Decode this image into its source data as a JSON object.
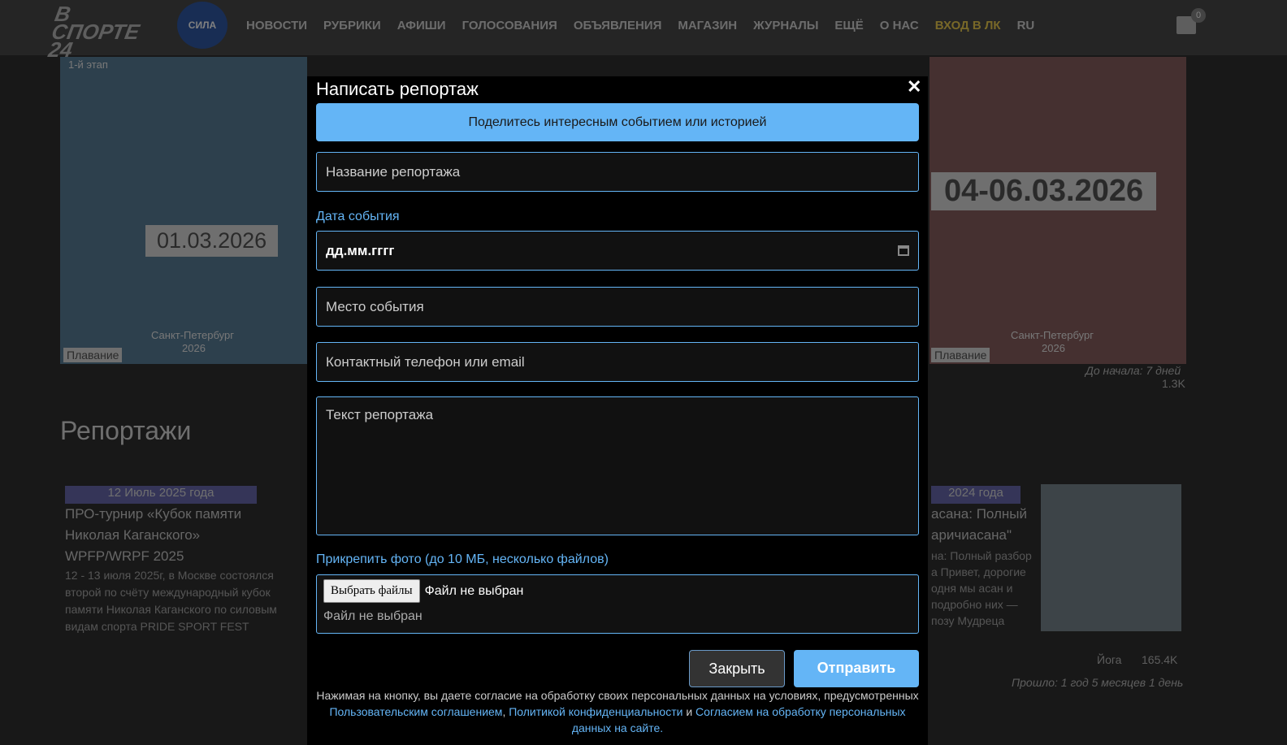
{
  "header": {
    "logo": "В СПОРТЕ 24",
    "partner_logo": "СИЛА",
    "nav": [
      "НОВОСТИ",
      "РУБРИКИ",
      "АФИШИ",
      "ГОЛОСОВАНИЯ",
      "ОБЪЯВЛЕНИЯ",
      "МАГАЗИН",
      "ЖУРНАЛЫ",
      "ЕЩЁ",
      "О НАС"
    ],
    "login": "ВХОД В ЛК",
    "lang": "RU",
    "cart_count": "0"
  },
  "background": {
    "events": [
      {
        "date": "01.03.2026",
        "city": "Санкт-Петербург",
        "year": "2026",
        "tag": "Плавание",
        "label": "1-й этап"
      },
      {
        "date": "04-06.03.2026",
        "city": "Санкт-Петербург",
        "year": "2026",
        "tag": "Плавание",
        "countdown": "До начала: 7 дней",
        "views": "1.3K"
      }
    ],
    "section_title": "Репортажи",
    "articles": [
      {
        "date": "12 Июль 2025 года",
        "title": "ПРО-турнир «Кубок памяти Николая Каганского» WPFP/WRPF 2025",
        "excerpt": "12 - 13 июля 2025г, в Москве состоялся второй по счёту международный кубок памяти Николая Каганского по силовым видам спорта PRIDE SPORT FEST"
      },
      {
        "date": "2024 года",
        "title": "асана: Полный аричиасана\"",
        "excerpt": "на: Полный разбор а Привет, дорогие одня мы асан и подробно них — позу Мудреца",
        "tag": "Йога",
        "views": "165.4K",
        "elapsed": "Прошло: 1 год 5 месяцев 1 день"
      }
    ]
  },
  "modal": {
    "title": "Написать репортаж",
    "banner": "Поделитесь интересным событием или историей",
    "title_placeholder": "Название репортажа",
    "date_label": "Дата события",
    "date_placeholder": "дд.мм.гггг",
    "place_placeholder": "Место события",
    "contact_placeholder": "Контактный телефон или email",
    "text_placeholder": "Текст репортажа",
    "photo_label": "Прикрепить фото (до 10 МБ, несколько файлов)",
    "choose_files": "Выбрать файлы",
    "no_file": "Файл не выбран",
    "no_file_status": "Файл не выбран",
    "close_button": "Закрыть",
    "submit_button": "Отправить",
    "consent_text1": "Нажимая на кнопку, вы даете согласие на обработку своих персональных данных на условиях, предусмотренных ",
    "link_agreement": "Пользовательским соглашением",
    "sep1": ", ",
    "link_privacy": "Политикой конфиденциальности",
    "sep2": " и ",
    "link_consent": "Согласием на обработку персональных данных на сайте",
    "end": "."
  },
  "colors": {
    "accent": "#64b5f6",
    "modal_bg": "#000000"
  }
}
